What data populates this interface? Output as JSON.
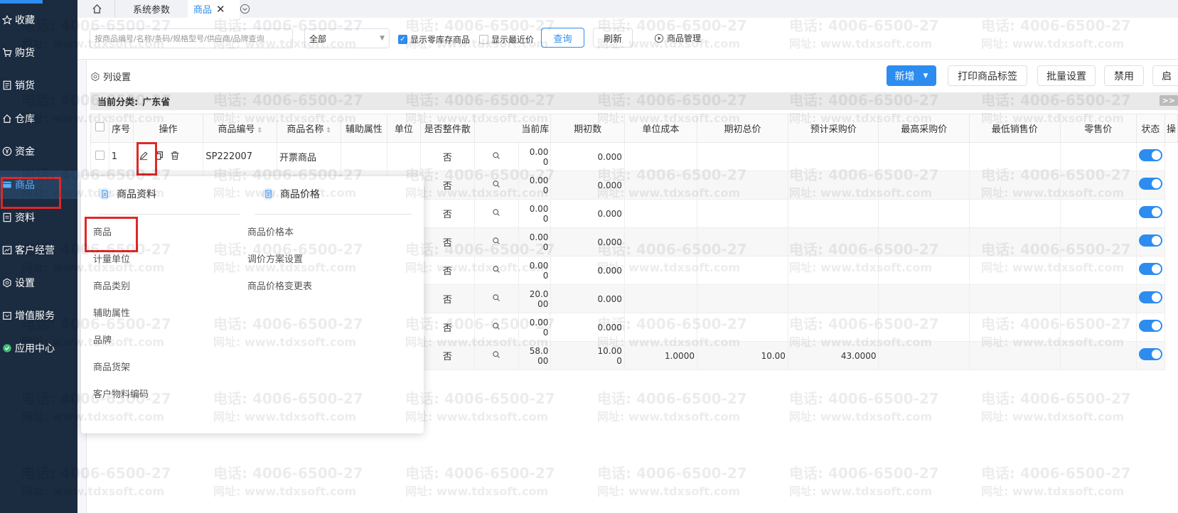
{
  "sidebar": {
    "items": [
      {
        "label": "收藏",
        "icon": "star-icon"
      },
      {
        "label": "购货",
        "icon": "cart-icon"
      },
      {
        "label": "销货",
        "icon": "receipt-icon"
      },
      {
        "label": "仓库",
        "icon": "home-icon"
      },
      {
        "label": "资金",
        "icon": "yen-icon"
      },
      {
        "label": "商品",
        "icon": "box-icon"
      },
      {
        "label": "资料",
        "icon": "doc-icon"
      },
      {
        "label": "客户经营",
        "icon": "chart-icon"
      },
      {
        "label": "设置",
        "icon": "gear-icon"
      },
      {
        "label": "增值服务",
        "icon": "gift-icon"
      },
      {
        "label": "应用中心",
        "icon": "app-icon"
      }
    ]
  },
  "tabs": {
    "t1": "系统参数",
    "t2": "商品"
  },
  "toolbar": {
    "search_placeholder": "按商品编号/名称/条码/规格型号/供应商/品牌查询",
    "select_value": "全部",
    "show_zero_stock": "显示零库存商品",
    "show_recent_price": "显示最近价",
    "query": "查询",
    "refresh": "刷新",
    "product_mgmt": "商品管理"
  },
  "col_settings": "列设置",
  "actions": {
    "add": "新增",
    "print_label": "打印商品标签",
    "batch_settings": "批量设置",
    "disable": "禁用",
    "enable": "启用"
  },
  "category": {
    "prefix": "当前分类:",
    "name": "广东省",
    "expand": ">>"
  },
  "table": {
    "headers": [
      "序号",
      "操作",
      "商品编号",
      "商品名称",
      "辅助属性",
      "单位",
      "是否整件散",
      "当前库",
      "期初数",
      "单位成本",
      "期初总价",
      "预计采购价",
      "最高采购价",
      "最低销售价",
      "零售价",
      "状态",
      "操"
    ],
    "rows": [
      {
        "seq": "1",
        "code": "SP222007",
        "name": "开票商品",
        "whole": "否",
        "stock_a": "0.00",
        "stock_b": "0",
        "init": "0.000",
        "cost": "",
        "total": "",
        "purchase": ""
      },
      {
        "seq": "",
        "code": "",
        "name": "",
        "whole": "否",
        "stock_a": "0.00",
        "stock_b": "0",
        "init": "0.000",
        "cost": "",
        "total": "",
        "purchase": ""
      },
      {
        "seq": "",
        "code": "",
        "name": "",
        "whole": "否",
        "stock_a": "0.00",
        "stock_b": "0",
        "init": "0.000",
        "cost": "",
        "total": "",
        "purchase": ""
      },
      {
        "seq": "",
        "code": "",
        "name": "",
        "whole": "否",
        "stock_a": "0.00",
        "stock_b": "0",
        "init": "0.000",
        "cost": "",
        "total": "",
        "purchase": ""
      },
      {
        "seq": "",
        "code": "",
        "name": "",
        "whole": "否",
        "stock_a": "0.00",
        "stock_b": "0",
        "init": "0.000",
        "cost": "",
        "total": "",
        "purchase": ""
      },
      {
        "seq": "",
        "code": "",
        "name": "",
        "whole": "否",
        "stock_a": "20.0",
        "stock_b": "00",
        "init": "0.000",
        "cost": "",
        "total": "",
        "purchase": ""
      },
      {
        "seq": "",
        "code": "",
        "name": "",
        "whole": "否",
        "stock_a": "0.00",
        "stock_b": "0",
        "init": "0.000",
        "cost": "",
        "total": "",
        "purchase": ""
      },
      {
        "seq": "",
        "code": "",
        "name": "",
        "whole": "否",
        "stock_a": "58.0",
        "stock_b": "00",
        "init": "10.00\n0",
        "cost": "1.0000",
        "total": "10.00",
        "purchase": "43.0000"
      }
    ]
  },
  "dropdown": {
    "col1": {
      "title": "商品资料",
      "items": [
        "商品",
        "计量单位",
        "商品类别",
        "辅助属性",
        "品牌",
        "商品货架",
        "客户物料编码"
      ]
    },
    "col2": {
      "title": "商品价格",
      "items": [
        "商品价格本",
        "调价方案设置",
        "商品价格变更表"
      ]
    }
  },
  "watermark": {
    "phone": "电话: 4006-6500-27",
    "web": "网址: www.tdxsoft.com"
  },
  "colors": {
    "sidebar": "#1b2b40",
    "accent": "#2d8cf0",
    "highlight": "#e02828"
  }
}
